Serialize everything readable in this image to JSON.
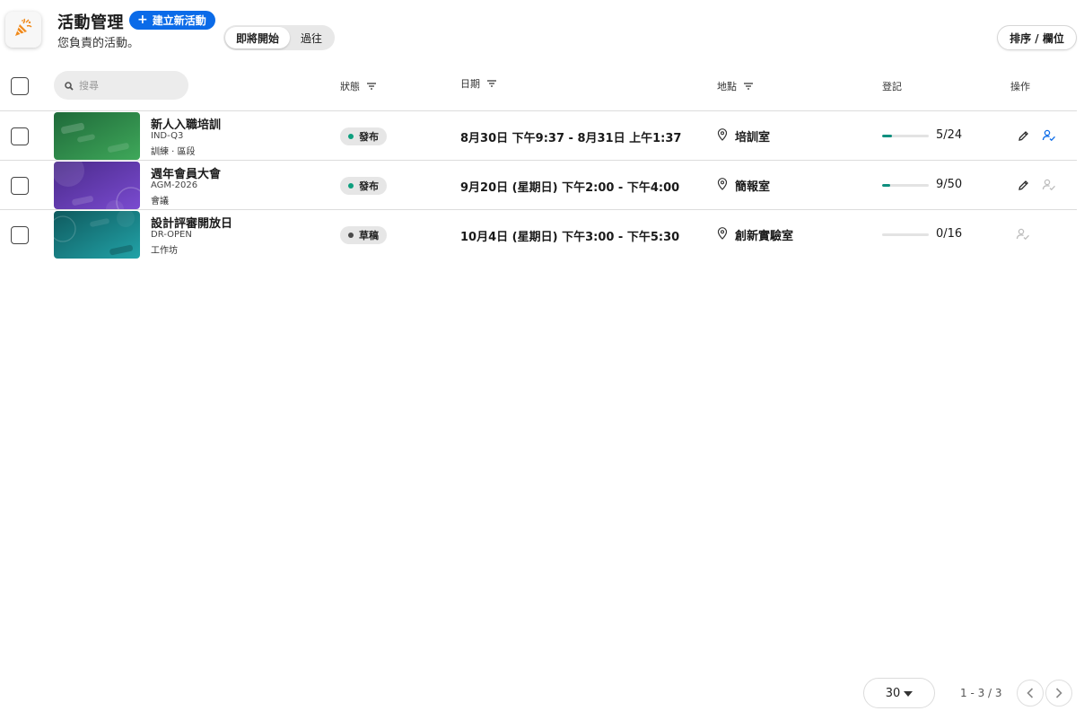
{
  "header": {
    "title": "活動管理",
    "subtitle": "您負責的活動。",
    "create_label": "建立新活動",
    "tabs": [
      {
        "label": "即將開始",
        "active": true
      },
      {
        "label": "過往",
        "active": false
      }
    ],
    "sort_label": "排序 / 欄位",
    "logo_icon": "party-popper-icon"
  },
  "search": {
    "placeholder": "搜尋"
  },
  "columns": {
    "status": "狀態",
    "date": "日期",
    "location": "地點",
    "registration": "登記",
    "actions": "操作"
  },
  "colors": {
    "accent": "#0b6be8",
    "published_dot": "#0e9f7e",
    "draft_dot": "#4a4a4a",
    "progress": "#0e8f7e"
  },
  "events": [
    {
      "title": "新人入職培訓",
      "code": "IND-Q3",
      "category": "訓練 · 區段",
      "status": "發布",
      "status_type": "published",
      "date": "8月30日 下午9:37 - 8月31日 上午1:37",
      "location": "培訓室",
      "registered": 5,
      "capacity": 24,
      "count": "5/24",
      "thumb_color": "green"
    },
    {
      "title": "週年會員大會",
      "code": "AGM-2026",
      "category": "會議",
      "status": "發布",
      "status_type": "published",
      "date": "9月20日 (星期日) 下午2:00 - 下午4:00",
      "location": "簡報室",
      "registered": 9,
      "capacity": 50,
      "count": "9/50",
      "thumb_color": "purple"
    },
    {
      "title": "設計評審開放日",
      "code": "DR-OPEN",
      "category": "工作坊",
      "status": "草稿",
      "status_type": "draft",
      "date": "10月4日 (星期日) 下午3:00 - 下午5:30",
      "location": "創新實驗室",
      "registered": 0,
      "capacity": 16,
      "count": "0/16",
      "thumb_color": "teal"
    }
  ],
  "footer": {
    "per_page": "30",
    "range": "1 - 3 / 3"
  }
}
